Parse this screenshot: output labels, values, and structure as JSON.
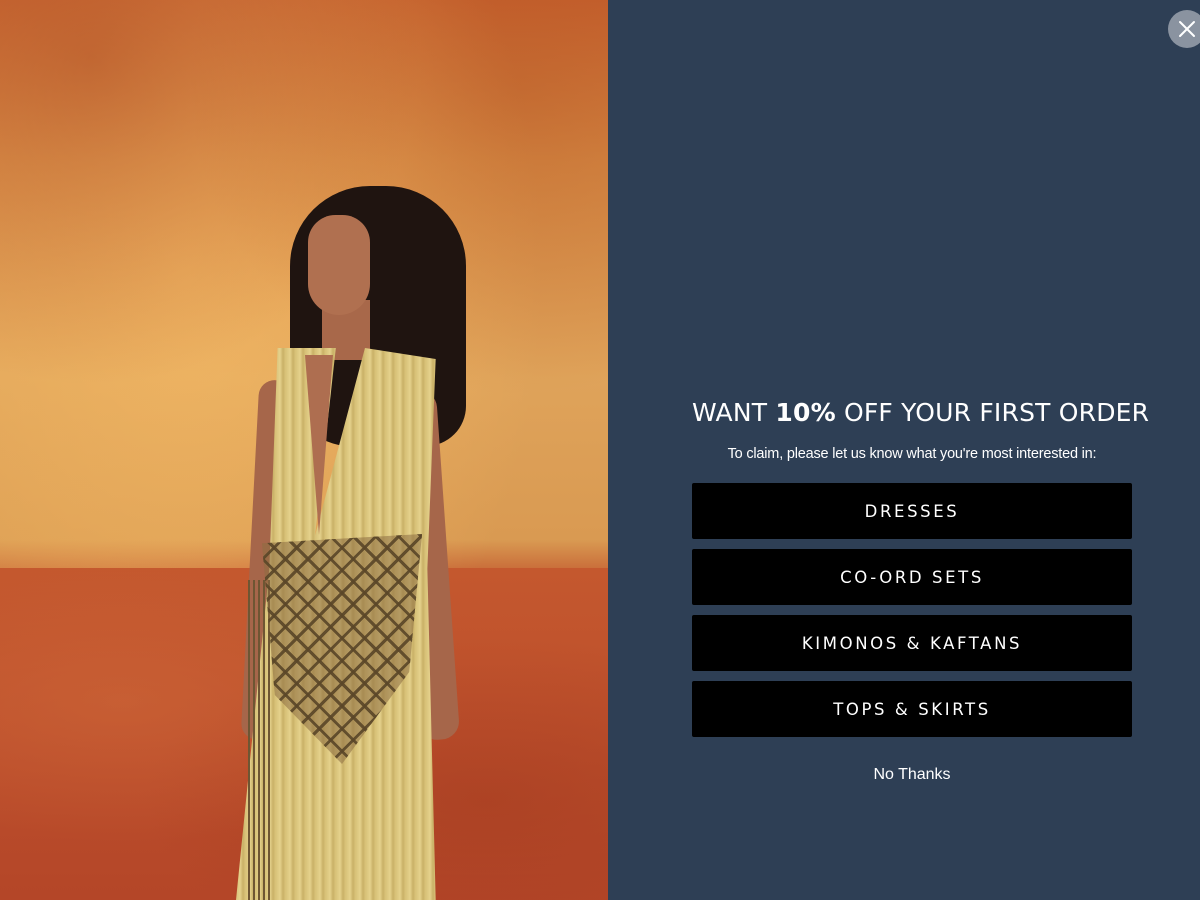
{
  "popup": {
    "headline_prefix": "WANT ",
    "headline_bold": "10%",
    "headline_suffix": " OFF YOUR FIRST ORDER",
    "subtext": "To claim, please let us know what you're most interested in:",
    "options": [
      {
        "label": "DRESSES"
      },
      {
        "label": "CO-ORD SETS"
      },
      {
        "label": "KIMONOS & KAFTANS"
      },
      {
        "label": "TOPS & SKIRTS"
      }
    ],
    "dismiss_label": "No Thanks",
    "close_icon": "close-icon"
  },
  "colors": {
    "panel_background": "#2e3f55",
    "button_background": "#000000",
    "text": "#ffffff",
    "close_button": "#8a93a0"
  }
}
